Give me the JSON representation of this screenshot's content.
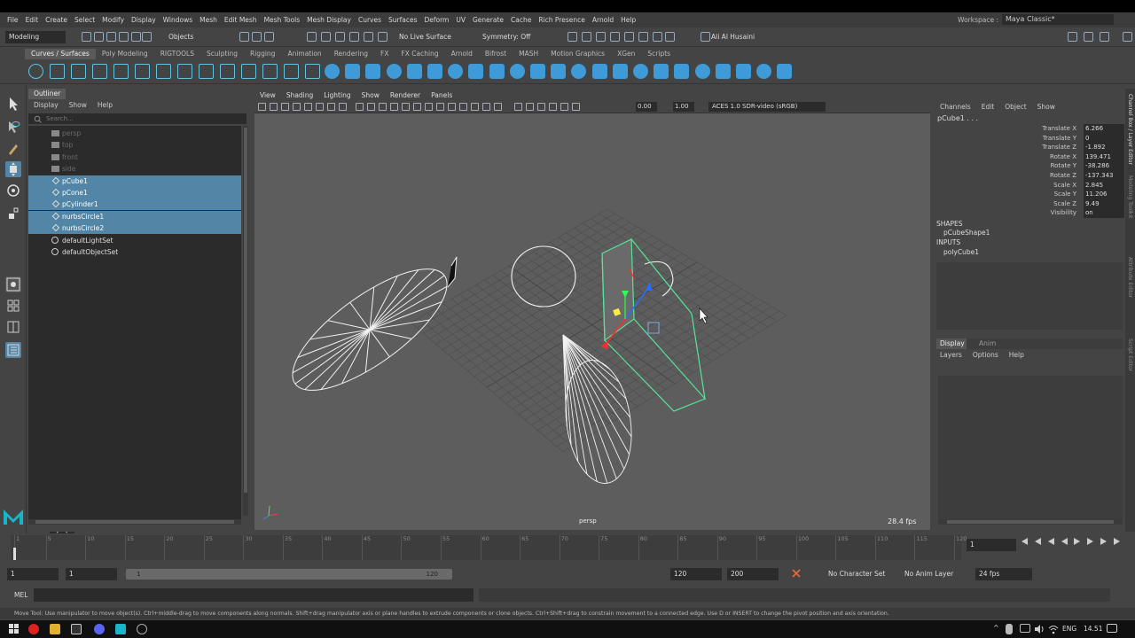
{
  "menubar": {
    "items": [
      "File",
      "Edit",
      "Create",
      "Select",
      "Modify",
      "Display",
      "Windows",
      "Mesh",
      "Edit Mesh",
      "Mesh Tools",
      "Mesh Display",
      "Curves",
      "Surfaces",
      "Deform",
      "UV",
      "Generate",
      "Cache",
      "Rich Presence",
      "Arnold",
      "Help"
    ],
    "workspace_label": "Workspace :",
    "workspace_value": "Maya Classic*"
  },
  "statusline": {
    "mode": "Modeling",
    "selection_mode": "Objects",
    "live_surface": "No Live Surface",
    "symmetry": "Symmetry: Off",
    "user": "Ali Al Husaini"
  },
  "shelf": {
    "tabs": [
      "Curves / Surfaces",
      "Poly Modeling",
      "RIGTOOLS",
      "Sculpting",
      "Rigging",
      "Animation",
      "Rendering",
      "FX",
      "FX Caching",
      "Arnold",
      "Bifrost",
      "MASH",
      "Motion Graphics",
      "XGen",
      "Scripts"
    ],
    "active_tab": 0
  },
  "outliner": {
    "title": "Outliner",
    "menu": [
      "Display",
      "Show",
      "Help"
    ],
    "search_placeholder": "Search...",
    "items": [
      {
        "label": "persp",
        "state": "dim",
        "icon": "camera-icon"
      },
      {
        "label": "top",
        "state": "dim",
        "icon": "camera-icon"
      },
      {
        "label": "front",
        "state": "dim",
        "icon": "camera-icon"
      },
      {
        "label": "side",
        "state": "dim",
        "icon": "camera-icon"
      },
      {
        "label": "pCube1",
        "state": "selected",
        "icon": "transform-icon"
      },
      {
        "label": "pCone1",
        "state": "selected",
        "icon": "transform-icon"
      },
      {
        "label": "pCylinder1",
        "state": "selected",
        "icon": "transform-icon"
      },
      {
        "label": "nurbsCircle1",
        "state": "selected",
        "icon": "transform-icon"
      },
      {
        "label": "nurbsCircle2",
        "state": "selected",
        "icon": "transform-icon"
      },
      {
        "label": "defaultLightSet",
        "state": "normal",
        "icon": "set-icon"
      },
      {
        "label": "defaultObjectSet",
        "state": "normal",
        "icon": "set-icon"
      }
    ]
  },
  "viewport": {
    "menu": [
      "View",
      "Shading",
      "Lighting",
      "Show",
      "Renderer",
      "Panels"
    ],
    "exposure": "0.00",
    "gamma": "1.00",
    "color_space": "ACES 1.0 SDR-video (sRGB)",
    "camera_label": "persp",
    "fps": "28.4 fps"
  },
  "channelbox": {
    "menu": [
      "Channels",
      "Edit",
      "Object",
      "Show"
    ],
    "object_name": "pCube1 . . .",
    "attributes": [
      {
        "label": "Translate X",
        "value": "6.266"
      },
      {
        "label": "Translate Y",
        "value": "0"
      },
      {
        "label": "Translate Z",
        "value": "-1.892"
      },
      {
        "label": "Rotate X",
        "value": "139.471"
      },
      {
        "label": "Rotate Y",
        "value": "-38.286"
      },
      {
        "label": "Rotate Z",
        "value": "-137.343"
      },
      {
        "label": "Scale X",
        "value": "2.845"
      },
      {
        "label": "Scale Y",
        "value": "11.206"
      },
      {
        "label": "Scale Z",
        "value": "9.49"
      },
      {
        "label": "Visibility",
        "value": "on"
      }
    ],
    "shapes_header": "SHAPES",
    "shape_item": "pCubeShape1",
    "inputs_header": "INPUTS",
    "input_item": "polyCube1",
    "layer_tabs": [
      "Display",
      "Anim"
    ],
    "layer_menu": [
      "Layers",
      "Options",
      "Help"
    ]
  },
  "sidetabs": [
    "Channel Box / Layer Editor",
    "Modeling Toolkit",
    "Attribute Editor",
    "Script Editor"
  ],
  "timeline": {
    "ticks": [
      "1",
      "5",
      "10",
      "15",
      "20",
      "25",
      "30",
      "35",
      "40",
      "45",
      "50",
      "55",
      "60",
      "65",
      "70",
      "75",
      "80",
      "85",
      "90",
      "95",
      "100",
      "105",
      "110",
      "115",
      "120"
    ],
    "current_frame": "1",
    "range_start": "1",
    "playback_start": "1",
    "slider_start": "1",
    "slider_end": "120",
    "playback_end": "120",
    "range_end": "200",
    "character_set": "No Character Set",
    "anim_layer": "No Anim Layer",
    "fps_setting": "24 fps"
  },
  "commandline": {
    "label": "MEL"
  },
  "helpline": "Move Tool: Use manipulator to move object(s). Ctrl+middle-drag to move components along normals. Shift+drag manipulator axis or plane handles to extrude components or clone objects. Ctrl+Shift+drag to constrain movement to a connected edge. Use D or INSERT to change the pivot position and axis orientation.",
  "taskbar": {
    "language": "ENG",
    "time": "14.51"
  },
  "colors": {
    "selection": "#5285a6",
    "viewport_bg": "#5d5d5d",
    "active_wire": "#57e39a"
  }
}
